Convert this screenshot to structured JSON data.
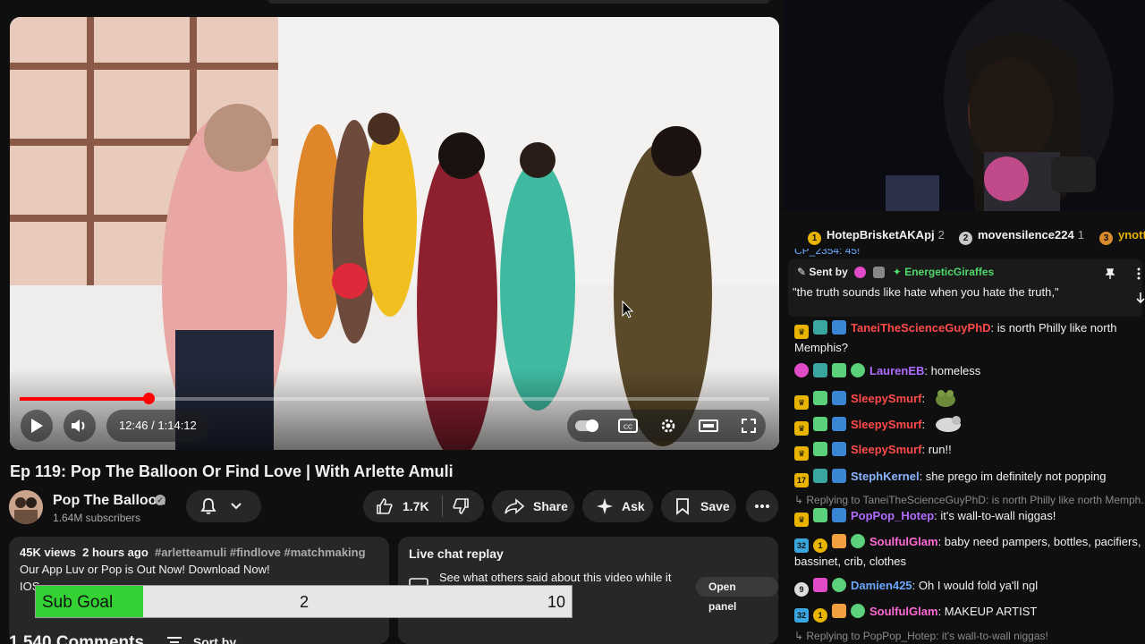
{
  "video": {
    "current_time": "12:46",
    "duration": "1:14:12",
    "progress_fraction": 0.172,
    "title": "Ep 119: Pop The Balloon Or Find Love | With Arlette Amuli"
  },
  "channel": {
    "name": "Pop The Balloon",
    "subscribers": "1.64M subscribers"
  },
  "actions": {
    "likes": "1.7K",
    "share": "Share",
    "ask": "Ask",
    "save": "Save"
  },
  "description": {
    "views": "45K views",
    "age": "2 hours ago",
    "hashtags": "#arletteamuli #findlove #matchmaking",
    "line1": "Our App Luv or Pop is Out Now! Download Now!",
    "line2": "IOS"
  },
  "live_chat_replay": {
    "title": "Live chat replay",
    "text": "See what others said about this video while it",
    "button": "Open panel"
  },
  "comments": {
    "count_label": "1,540 Comments",
    "sort_label": "Sort by"
  },
  "sub_goal": {
    "label": "Sub Goal",
    "current": "2",
    "target": "10",
    "fraction": 0.2
  },
  "leaderboard": [
    {
      "rank": "1",
      "name": "HotepBrisketAKApj",
      "count": "2",
      "color": "#e8b400"
    },
    {
      "rank": "2",
      "name": "movensilence224",
      "count": "1",
      "color": "#c8c8c8"
    },
    {
      "rank": "3",
      "name": "ynott",
      "count": "",
      "color": "#d98b2b"
    }
  ],
  "chat": {
    "pinned": {
      "sent_by": "Sent by",
      "user": "EnergeticGiraffes",
      "user_color": "#4fd96b",
      "text": "\"the truth sounds like hate when you hate the truth,\""
    },
    "messages": [
      {
        "user": "TaneiTheScienceGuyPhD",
        "color": "#ff4a4a",
        "text": ": is north Philly like north Memphis?"
      },
      {
        "user": "LaurenEB",
        "color": "#b06cff",
        "text": ": homeless"
      },
      {
        "user": "SleepySmurf",
        "color": "#ff4a4a",
        "text": ":"
      },
      {
        "user": "SleepySmurf",
        "color": "#ff4a4a",
        "text": ":"
      },
      {
        "user": "SleepySmurf",
        "color": "#ff4a4a",
        "text": ": run!!"
      },
      {
        "user": "StephKernel",
        "color": "#8ab4ff",
        "text": ": she prego im definitely not popping"
      },
      {
        "user": "PopPop_Hotep",
        "color": "#b06cff",
        "text": ": it's wall-to-wall niggas!"
      },
      {
        "user": "SoulfulGlam",
        "color": "#ff6ad5",
        "text": ": baby need pampers, bottles, pacifiers, bassinet, crib, clothes"
      },
      {
        "user": "Damien425",
        "color": "#6aa8ff",
        "text": ": Oh I would fold ya'll ngl"
      },
      {
        "user": "SoulfulGlam",
        "color": "#ff6ad5",
        "text": ": MAKEUP ARTIST"
      }
    ],
    "replies": [
      "Replying to TaneiTheScienceGuyPhD: is north Philly like north Memph...",
      "Replying to PopPop_Hotep: it's wall-to-wall niggas!"
    ],
    "partial_top": "CP_2354: 45!"
  }
}
